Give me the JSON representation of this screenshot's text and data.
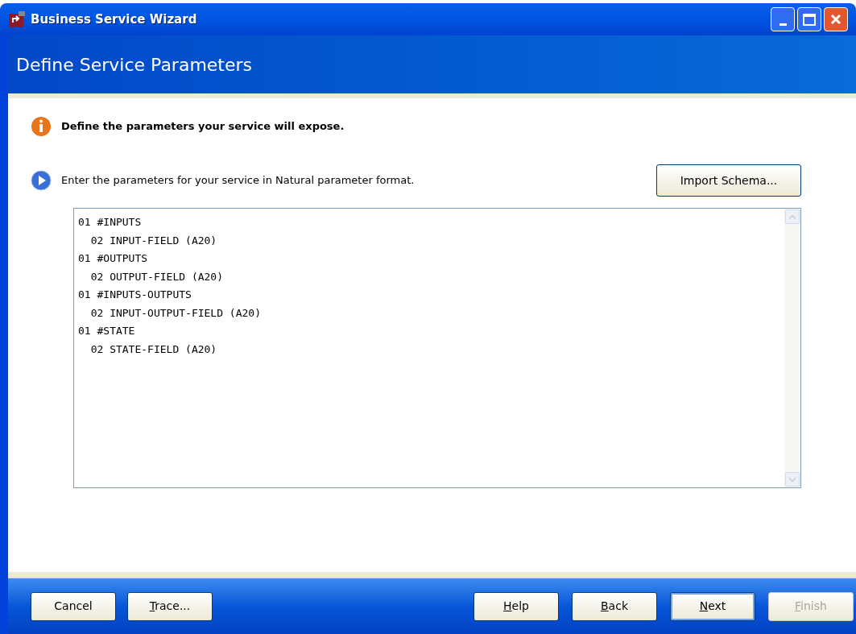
{
  "window": {
    "title": "Business Service Wizard"
  },
  "header": {
    "title": "Define Service Parameters"
  },
  "instruction": "Define the parameters your service will expose.",
  "prompt": "Enter the parameters for your service in Natural parameter format.",
  "import_button": {
    "label": "Import Schema..."
  },
  "editor": {
    "lines": [
      "01 #INPUTS",
      "  02 INPUT-FIELD (A20)",
      "01 #OUTPUTS",
      "  02 OUTPUT-FIELD (A20)",
      "01 #INPUTS-OUTPUTS",
      "  02 INPUT-OUTPUT-FIELD (A20)",
      "01 #STATE",
      "  02 STATE-FIELD (A20)"
    ]
  },
  "buttons_left": [
    {
      "rest": "Cancel",
      "disabled": false,
      "default": false
    },
    {
      "key": "T",
      "rest": "race...",
      "disabled": false,
      "default": false
    }
  ],
  "buttons_right": [
    {
      "key": "H",
      "rest": "elp",
      "disabled": false,
      "default": false
    },
    {
      "key": "B",
      "rest": "ack",
      "disabled": false,
      "default": false
    },
    {
      "key": "N",
      "rest": "ext",
      "disabled": false,
      "default": true
    },
    {
      "key": "F",
      "rest": "inish",
      "disabled": true,
      "default": false
    }
  ]
}
